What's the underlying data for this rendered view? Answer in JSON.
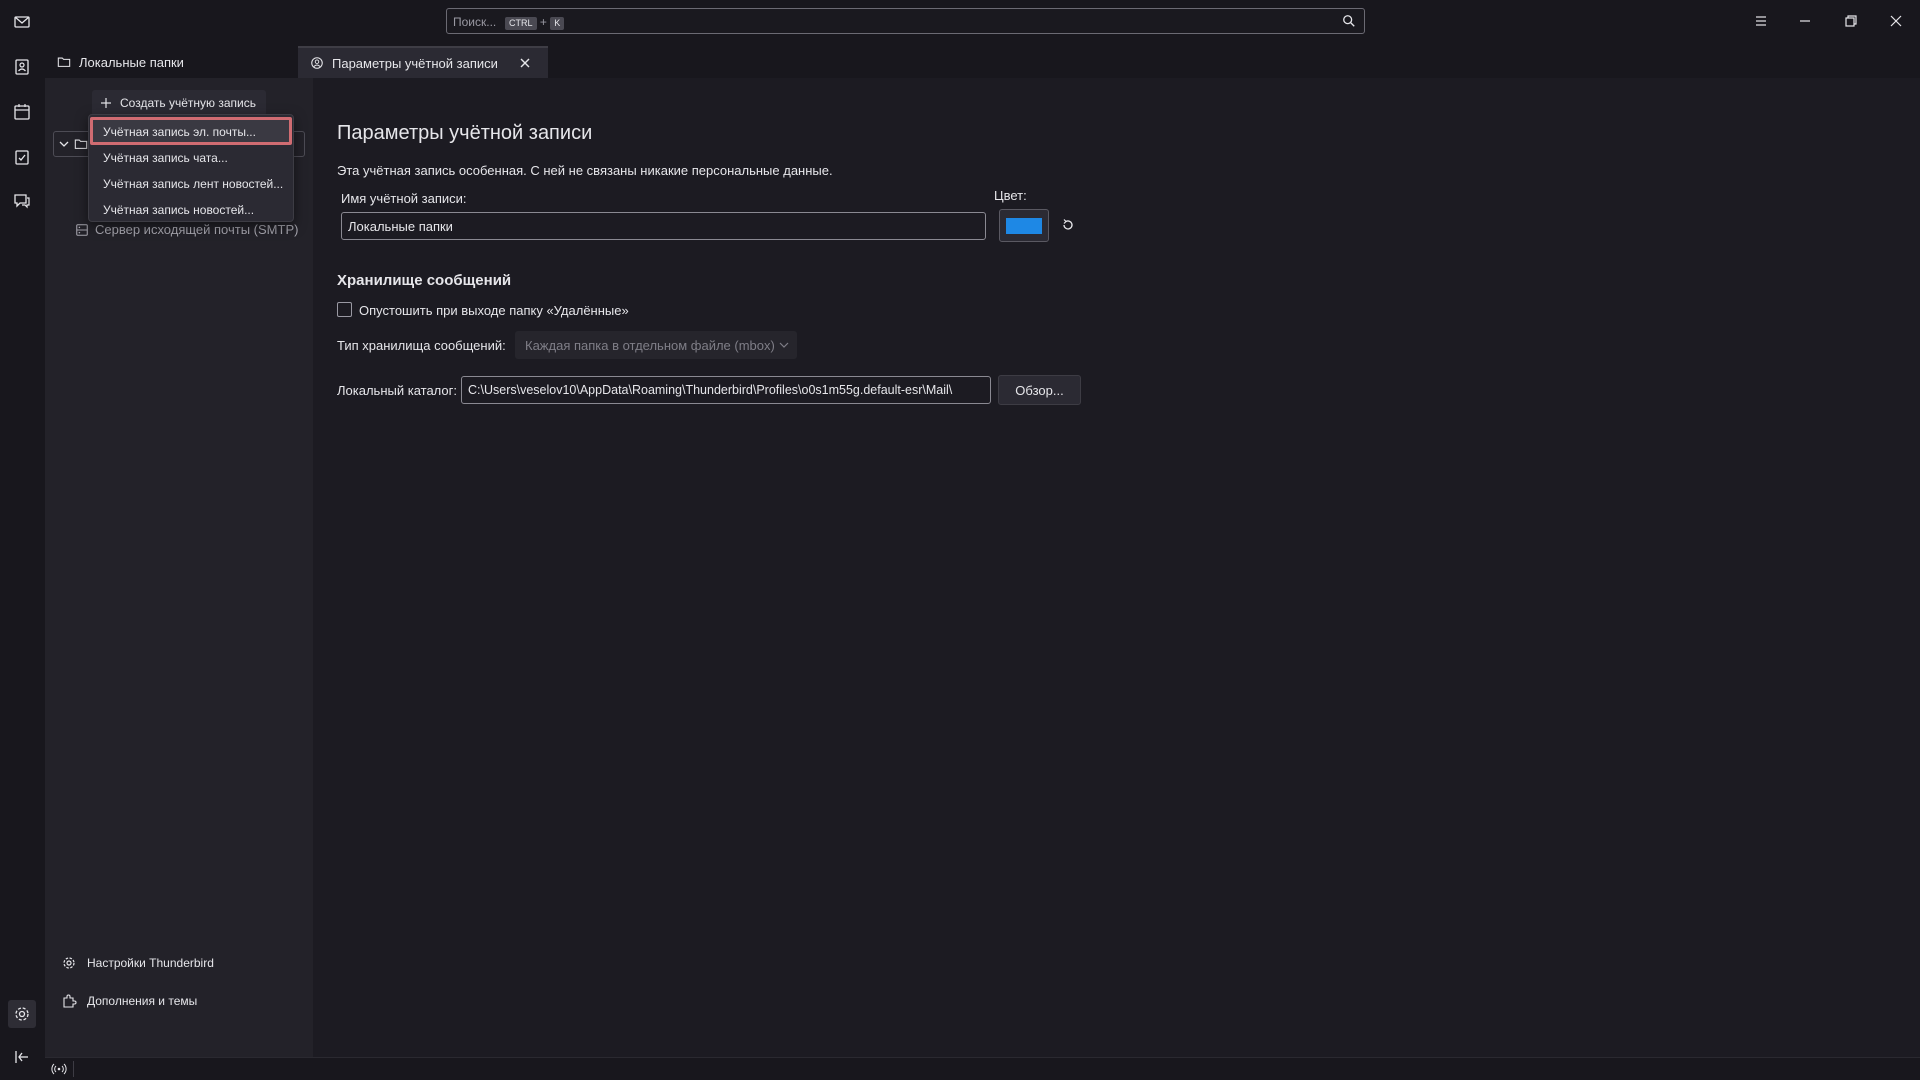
{
  "search": {
    "placeholder": "Поиск...",
    "key1": "CTRL",
    "plus": "+",
    "key2": "K"
  },
  "tabs": [
    {
      "label": "Локальные папки",
      "icon": "folder-icon"
    },
    {
      "label": "Параметры учётной записи",
      "icon": "account-settings-icon"
    }
  ],
  "folder_pane": {
    "create_account_label": "Создать учётную запись",
    "smtp_label": "Сервер исходящей почты (SMTP)",
    "footer": {
      "settings_label": "Настройки Thunderbird",
      "addons_label": "Дополнения и темы"
    }
  },
  "account_menu": {
    "items": [
      "Учётная запись эл. почты...",
      "Учётная запись чата...",
      "Учётная запись лент новостей...",
      "Учётная запись новостей..."
    ]
  },
  "main": {
    "title": "Параметры учётной записи",
    "description": "Эта учётная запись особенная. С ней не связаны никакие персональные данные.",
    "account_name_label": "Имя учётной записи:",
    "account_name_value": "Локальные папки",
    "color_label": "Цвет:",
    "accent_color": "#1e88e5",
    "storage_title": "Хранилище сообщений",
    "empty_trash_label": "Опустошить при выходе папку «Удалённые»",
    "store_type_label": "Тип хранилища сообщений:",
    "store_type_value": "Каждая папка в отдельном файле (mbox)",
    "local_dir_label": "Локальный каталог:",
    "local_dir_value": "C:\\Users\\veselov10\\AppData\\Roaming\\Thunderbird\\Profiles\\o0s1m55g.default-esr\\Mail\\",
    "browse_label": "Обзор..."
  }
}
